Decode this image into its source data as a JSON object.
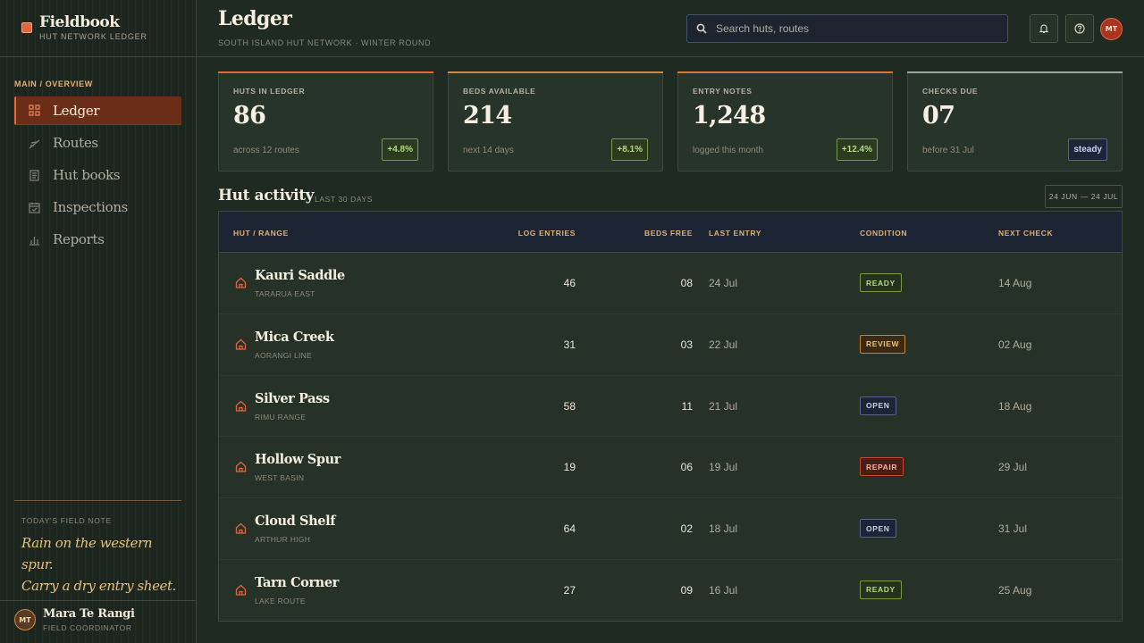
{
  "brand": {
    "title": "Fieldbook",
    "subtitle": "HUT NETWORK LEDGER",
    "accent": "#e3663b"
  },
  "sidebar": {
    "section_label": "MAIN / OVERVIEW",
    "items": [
      {
        "label": "Ledger",
        "icon": "grid-icon",
        "active": true
      },
      {
        "label": "Routes",
        "icon": "route-icon"
      },
      {
        "label": "Hut books",
        "icon": "book-icon"
      },
      {
        "label": "Inspections",
        "icon": "calendar-check-icon"
      },
      {
        "label": "Reports",
        "icon": "bar-chart-icon"
      }
    ],
    "field_note": {
      "label": "TODAY'S FIELD NOTE",
      "line1": "Rain on the western spur.",
      "line2": "Carry a dry entry sheet."
    },
    "user": {
      "initials": "MT",
      "name": "Mara Te Rangi",
      "role": "FIELD COORDINATOR"
    }
  },
  "header": {
    "title": "Ledger",
    "subtitle": "SOUTH ISLAND HUT NETWORK · WINTER ROUND",
    "search_placeholder": "Search huts, routes",
    "avatar_initials": "MT"
  },
  "stats": [
    {
      "label": "HUTS IN LEDGER",
      "value": "86",
      "foot": "across 12 routes",
      "delta": "+4.8%",
      "kind": "up",
      "color": "#e3663b"
    },
    {
      "label": "BEDS AVAILABLE",
      "value": "214",
      "foot": "next 14 days",
      "delta": "+8.1%",
      "kind": "up",
      "color": "#c98a4a"
    },
    {
      "label": "ENTRY NOTES",
      "value": "1,248",
      "foot": "logged this month",
      "delta": "+12.4%",
      "kind": "up",
      "color": "#d9773a"
    },
    {
      "label": "CHECKS DUE",
      "value": "07",
      "foot": "before 31 Jul",
      "delta": "steady",
      "kind": "steady",
      "color": "#9aa898"
    }
  ],
  "activity": {
    "title": "Hut activity",
    "subtitle": "LAST 30 DAYS",
    "date_range": "24 JUN — 24 JUL",
    "columns": [
      "HUT / RANGE",
      "LOG ENTRIES",
      "BEDS FREE",
      "LAST ENTRY",
      "CONDITION",
      "NEXT CHECK"
    ],
    "rows": [
      {
        "name": "Kauri Saddle",
        "range": "TARARUA EAST",
        "log": "46",
        "beds": "08",
        "last": "24 Jul",
        "condition": "READY",
        "next": "14 Aug"
      },
      {
        "name": "Mica Creek",
        "range": "AORANGI LINE",
        "log": "31",
        "beds": "03",
        "last": "22 Jul",
        "condition": "REVIEW",
        "next": "02 Aug"
      },
      {
        "name": "Silver Pass",
        "range": "RIMU RANGE",
        "log": "58",
        "beds": "11",
        "last": "21 Jul",
        "condition": "OPEN",
        "next": "18 Aug"
      },
      {
        "name": "Hollow Spur",
        "range": "WEST BASIN",
        "log": "19",
        "beds": "06",
        "last": "19 Jul",
        "condition": "REPAIR",
        "next": "29 Jul"
      },
      {
        "name": "Cloud Shelf",
        "range": "ARTHUR HIGH",
        "log": "64",
        "beds": "02",
        "last": "18 Jul",
        "condition": "OPEN",
        "next": "31 Jul"
      },
      {
        "name": "Tarn Corner",
        "range": "LAKE ROUTE",
        "log": "27",
        "beds": "09",
        "last": "16 Jul",
        "condition": "READY",
        "next": "25 Aug"
      }
    ]
  }
}
